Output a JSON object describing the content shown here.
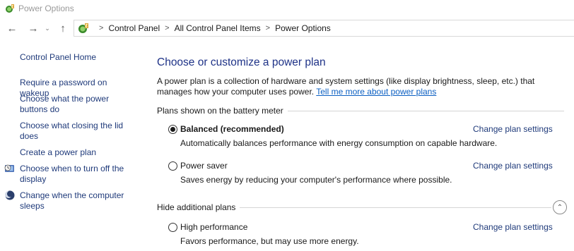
{
  "window": {
    "title": "Power Options"
  },
  "nav": {
    "back": "←",
    "forward": "→",
    "recent": "⌄",
    "up": "↑",
    "breadcrumbs": [
      "Control Panel",
      "All Control Panel Items",
      "Power Options"
    ],
    "separator": ">"
  },
  "sidebar": {
    "home": "Control Panel Home",
    "links": [
      "Require a password on wakeup",
      "Choose what the power buttons do",
      "Choose what closing the lid does",
      "Create a power plan",
      "Choose when to turn off the display",
      "Change when the computer sleeps"
    ]
  },
  "main": {
    "heading": "Choose or customize a power plan",
    "intro": "A power plan is a collection of hardware and system settings (like display brightness, sleep, etc.) that manages how your computer uses power.",
    "intro_link": "Tell me more about power plans",
    "section_shown": "Plans shown on the battery meter",
    "section_hidden": "Hide additional plans",
    "plans": [
      {
        "name": "Balanced (recommended)",
        "description": "Automatically balances performance with energy consumption on capable hardware.",
        "selected": true,
        "change_label": "Change plan settings"
      },
      {
        "name": "Power saver",
        "description": "Saves energy by reducing your computer's performance where possible.",
        "selected": false,
        "change_label": "Change plan settings"
      },
      {
        "name": "High performance",
        "description": "Favors performance, but may use more energy.",
        "selected": false,
        "change_label": "Change plan settings"
      }
    ]
  },
  "colors": {
    "link": "#1f3a7a",
    "heading": "#1e3287",
    "hyperlink": "#0b5fc2"
  },
  "icons": [
    "power-options-icon",
    "back-arrow-icon",
    "forward-arrow-icon",
    "recent-locations-icon",
    "up-arrow-icon",
    "clock-monitor-icon",
    "moon-icon",
    "collapse-chevron-icon"
  ]
}
